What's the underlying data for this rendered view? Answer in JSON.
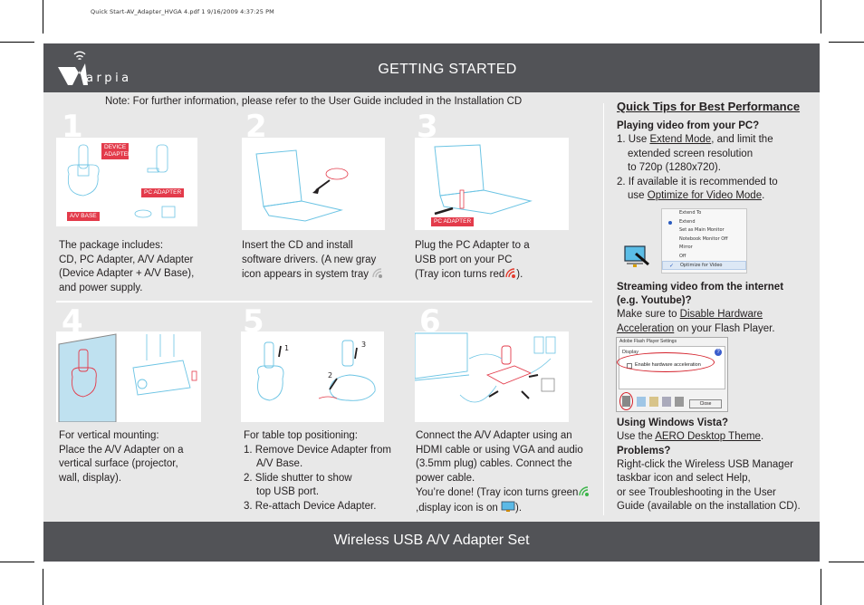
{
  "print_header": "Quick Start-AV_Adapter_HVGA 4.pdf   1   9/16/2009   4:37:25 PM",
  "header": {
    "logo_text": "arpia",
    "title": "GETTING STARTED"
  },
  "note": "Note: For further information, please refer to the User Guide included in the Installation CD",
  "steps": [
    {
      "number": "1",
      "tags": [
        "DEVICE ADAPTER",
        "PC ADAPTER",
        "A/V BASE"
      ],
      "lines": [
        "The package includes:",
        "CD, PC Adapter, A/V Adapter",
        "(Device Adapter + A/V Base),",
        "and power supply."
      ]
    },
    {
      "number": "2",
      "lines": [
        "Insert the CD and install",
        "software drivers. (A new gray",
        "icon appears in system tray"
      ],
      "tray_icon": "gray-tray-icon"
    },
    {
      "number": "3",
      "tags": [
        "PC ADAPTER"
      ],
      "lines": [
        "Plug the PC Adapter to a",
        "USB port on your PC",
        "(Tray icon turns red",
        ")."
      ],
      "tray_icon": "red-tray-icon"
    },
    {
      "number": "4",
      "lines": [
        "For vertical mounting:",
        "Place the A/V Adapter on a",
        "vertical surface (projector,",
        "wall, display)."
      ]
    },
    {
      "number": "5",
      "markers": [
        "1",
        "2",
        "3"
      ],
      "heading": "For table top positioning:",
      "items": [
        [
          "1. Remove Device Adapter from",
          "A/V Base."
        ],
        [
          "2. Slide shutter to show",
          "top USB port."
        ],
        [
          "3. Re-attach Device Adapter."
        ]
      ]
    },
    {
      "number": "6",
      "lines": [
        "Connect the A/V Adapter using an",
        "HDMI cable or using VGA and audio",
        "(3.5mm plug) cables. Connect the",
        "power cable."
      ],
      "done_a": "You’re done!  (Tray icon turns green",
      "done_b": ",display icon is on",
      "done_c": ")."
    }
  ],
  "tips": {
    "title": "Quick Tips for Best Performance",
    "section1": {
      "heading": "Playing video from your PC?",
      "item1_pre": "1. Use ",
      "item1_link": "Extend Mode",
      "item1_post": ", and limit the",
      "item1_l2": "extended screen resolution",
      "item1_l3": "to 720p (1280x720).",
      "item2_l1": "2. If available it is recommended to",
      "item2_pre": "use ",
      "item2_link": "Optimize for Video Mode",
      "item2_post": "."
    },
    "menu_items": [
      "Extend To",
      "Extend",
      "Set as Main Monitor",
      "Notebook Monitor Off",
      "Mirror",
      "Off",
      "Optimize for Video"
    ],
    "section2": {
      "heading_l1": "Streaming video from the internet",
      "heading_l2": "(e.g. Youtube)?",
      "pre": "Make sure to ",
      "link_l1": "Disable Hardware",
      "link_l2": "Acceleration",
      "post": " on your Flash Player."
    },
    "flash_dialog": {
      "title": "Adobe Flash Player Settings",
      "tab": "Display",
      "checkbox_label": "Enable hardware acceleration",
      "close_button": "Close"
    },
    "section3": {
      "heading": "Using Windows Vista?",
      "pre": "Use the ",
      "link": "AERO Desktop Theme",
      "post": "."
    },
    "section4": {
      "heading": "Problems?",
      "lines": [
        "Right-click the Wireless USB Manager",
        "taskbar icon and select Help,",
        "or see Troubleshooting in the User",
        "Guide (available on the installation CD)."
      ]
    }
  },
  "footer": {
    "title": "Wireless USB A/V Adapter Set"
  },
  "colors": {
    "bar": "#525357",
    "panel": "#e8e8e8",
    "accent_red": "#e33b4b",
    "line_blue": "#6cc4e4",
    "tray_green": "#3cb54a"
  }
}
